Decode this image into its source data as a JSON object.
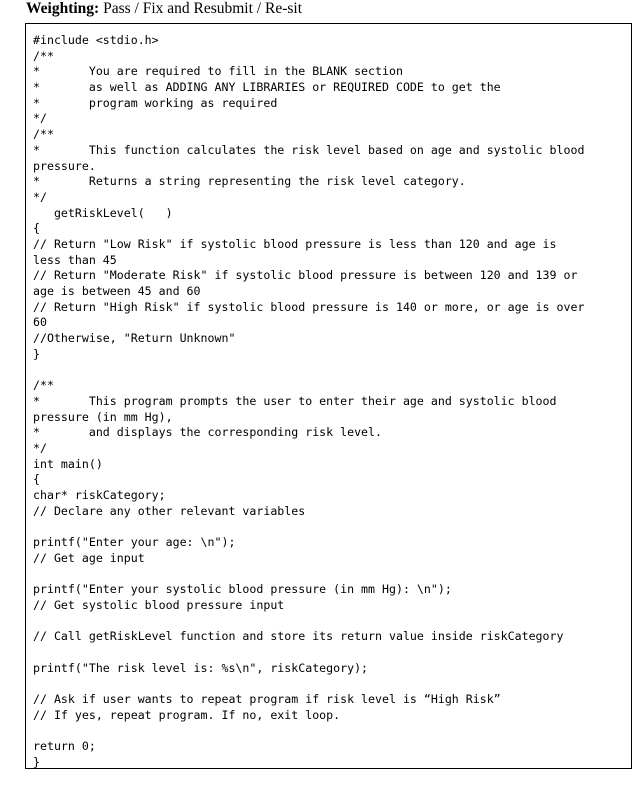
{
  "header": {
    "label": "Weighting:",
    "text": " Pass / Fix and Resubmit  / Re-sit"
  },
  "code_lines": [
    "#include <stdio.h>",
    "/**",
    "*       You are required to fill in the BLANK section",
    "*       as well as ADDING ANY LIBRARIES or REQUIRED CODE to get the",
    "*       program working as required",
    "*/",
    "/**",
    "*       This function calculates the risk level based on age and systolic blood",
    "pressure.",
    "*       Returns a string representing the risk level category.",
    "*/",
    "   getRiskLevel(   )",
    "{",
    "// Return \"Low Risk\" if systolic blood pressure is less than 120 and age is",
    "less than 45",
    "// Return \"Moderate Risk\" if systolic blood pressure is between 120 and 139 or",
    "age is between 45 and 60",
    "// Return \"High Risk\" if systolic blood pressure is 140 or more, or age is over",
    "60",
    "//Otherwise, \"Return Unknown\"",
    "}",
    "",
    "/**",
    "*       This program prompts the user to enter their age and systolic blood",
    "pressure (in mm Hg),",
    "*       and displays the corresponding risk level.",
    "*/",
    "int main()",
    "{",
    "char* riskCategory;",
    "// Declare any other relevant variables",
    "",
    "printf(\"Enter your age: \\n\");",
    "// Get age input",
    "",
    "printf(\"Enter your systolic blood pressure (in mm Hg): \\n\");",
    "// Get systolic blood pressure input",
    "",
    "// Call getRiskLevel function and store its return value inside riskCategory",
    "",
    "printf(\"The risk level is: %s\\n\", riskCategory);",
    "",
    "// Ask if user wants to repeat program if risk level is “High Risk”",
    "// If yes, repeat program. If no, exit loop.",
    "",
    "return 0;",
    "}"
  ]
}
